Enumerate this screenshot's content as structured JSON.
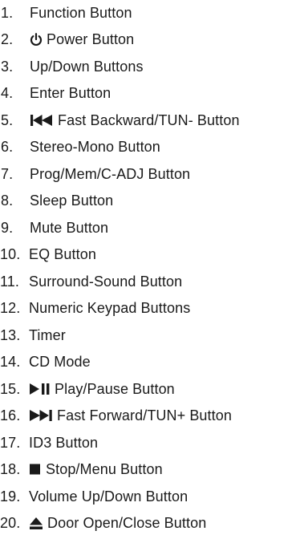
{
  "items": [
    {
      "number": "1.",
      "label": "Function Button",
      "icon": null
    },
    {
      "number": "2.",
      "label": "Power Button",
      "icon": "power-icon"
    },
    {
      "number": "3.",
      "label": "Up/Down Buttons",
      "icon": null
    },
    {
      "number": "4.",
      "label": "Enter Button",
      "icon": null
    },
    {
      "number": "5.",
      "label": "Fast Backward/TUN- Button",
      "icon": "fast-backward-icon"
    },
    {
      "number": "6.",
      "label": "Stereo-Mono Button",
      "icon": null
    },
    {
      "number": "7.",
      "label": "Prog/Mem/C-ADJ Button",
      "icon": null
    },
    {
      "number": "8.",
      "label": "Sleep Button",
      "icon": null
    },
    {
      "number": "9.",
      "label": "Mute Button",
      "icon": null
    },
    {
      "number": "10.",
      "label": "EQ Button",
      "icon": null
    },
    {
      "number": "11.",
      "label": "Surround-Sound Button",
      "icon": null
    },
    {
      "number": "12.",
      "label": "Numeric Keypad Buttons",
      "icon": null
    },
    {
      "number": "13.",
      "label": "Timer",
      "icon": null
    },
    {
      "number": "14.",
      "label": "CD Mode",
      "icon": null
    },
    {
      "number": "15.",
      "label": "Play/Pause Button",
      "icon": "play-pause-icon"
    },
    {
      "number": "16.",
      "label": "Fast Forward/TUN+ Button",
      "icon": "fast-forward-icon"
    },
    {
      "number": "17.",
      "label": "ID3 Button",
      "icon": null
    },
    {
      "number": "18.",
      "label": "Stop/Menu Button",
      "icon": "stop-icon"
    },
    {
      "number": "19.",
      "label": "Volume Up/Down Button",
      "icon": null
    },
    {
      "number": "20.",
      "label": "Door Open/Close Button",
      "icon": "eject-icon"
    }
  ]
}
